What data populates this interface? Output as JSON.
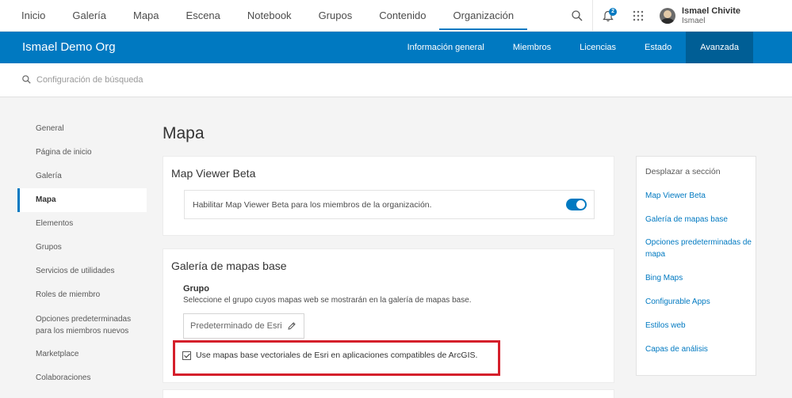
{
  "topnav": {
    "links": [
      "Inicio",
      "Galería",
      "Mapa",
      "Escena",
      "Notebook",
      "Grupos",
      "Contenido",
      "Organización"
    ],
    "active": "Organización",
    "notification_count": "2",
    "user_name": "Ismael Chivite",
    "user_sub": "Ismael"
  },
  "orgbar": {
    "org_name": "Ismael Demo Org",
    "tabs": [
      "Información general",
      "Miembros",
      "Licencias",
      "Estado",
      "Avanzada"
    ],
    "active": "Avanzada"
  },
  "search": {
    "placeholder": "Configuración de búsqueda"
  },
  "sidenav": {
    "items": [
      "General",
      "Página de inicio",
      "Galería",
      "Mapa",
      "Elementos",
      "Grupos",
      "Servicios de utilidades",
      "Roles de miembro",
      "Opciones predeterminadas para los miembros nuevos",
      "Marketplace",
      "Colaboraciones"
    ],
    "active": "Mapa"
  },
  "main": {
    "page_title": "Mapa",
    "map_viewer": {
      "title": "Map Viewer Beta",
      "toggle_label": "Habilitar Map Viewer Beta para los miembros de la organización.",
      "enabled": true
    },
    "basemap_gallery": {
      "title": "Galería de mapas base",
      "group_label": "Grupo",
      "group_desc": "Seleccione el grupo cuyos mapas web se mostrarán en la galería de mapas base.",
      "group_value": "Predeterminado de Esri",
      "vector_checkbox_label": "Use mapas base vectoriales de Esri en aplicaciones compatibles de ArcGIS.",
      "vector_checked": true
    }
  },
  "rpanel": {
    "title": "Desplazar a sección",
    "links": [
      "Map Viewer Beta",
      "Galería de mapas base",
      "Opciones predeterminadas de mapa",
      "Bing Maps",
      "Configurable Apps",
      "Estilos web",
      "Capas de análisis"
    ]
  },
  "colors": {
    "brand": "#0079c1",
    "highlight": "#d51f2b"
  }
}
